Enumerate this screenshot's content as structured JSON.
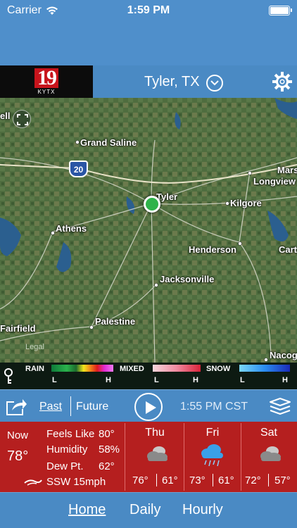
{
  "status": {
    "carrier": "Carrier",
    "time": "1:59 PM"
  },
  "header": {
    "logo_number": "19",
    "logo_call": "KYTX",
    "location": "Tyler, TX"
  },
  "map": {
    "labels": [
      "ell",
      "Grand Saline",
      "20",
      "Tyler",
      "Marsh",
      "Longview",
      "Kilgore",
      "Athens",
      "Henderson",
      "Cart",
      "Jacksonville",
      "Palestine",
      "Fairfield",
      "Nacog"
    ],
    "legal": "Legal"
  },
  "legend": {
    "rain": "RAIN",
    "mixed": "MIXED",
    "snow": "SNOW",
    "light": "L",
    "heavy": "H"
  },
  "controls": {
    "past": "Past",
    "future": "Future",
    "timestamp": "1:55 PM CST"
  },
  "current": {
    "now_label": "Now",
    "now_temp": "78°",
    "feels_like_label": "Feels Like",
    "feels_like": "80°",
    "humidity_label": "Humidity",
    "humidity": "58%",
    "dew_point_label": "Dew Pt.",
    "dew_point": "62°",
    "wind": "SSW 15mph"
  },
  "forecast": [
    {
      "day": "Thu",
      "icon": "cloudy-icon",
      "high": "76°",
      "low": "61°"
    },
    {
      "day": "Fri",
      "icon": "rain-icon",
      "high": "73°",
      "low": "61°"
    },
    {
      "day": "Sat",
      "icon": "cloudy-icon",
      "high": "72°",
      "low": "57°"
    }
  ],
  "tabs": {
    "home": "Home",
    "daily": "Daily",
    "hourly": "Hourly"
  },
  "colors": {
    "accent": "#4a8ac4",
    "forecast_bg": "#b51f1f",
    "location_dot": "#2fb34a"
  }
}
